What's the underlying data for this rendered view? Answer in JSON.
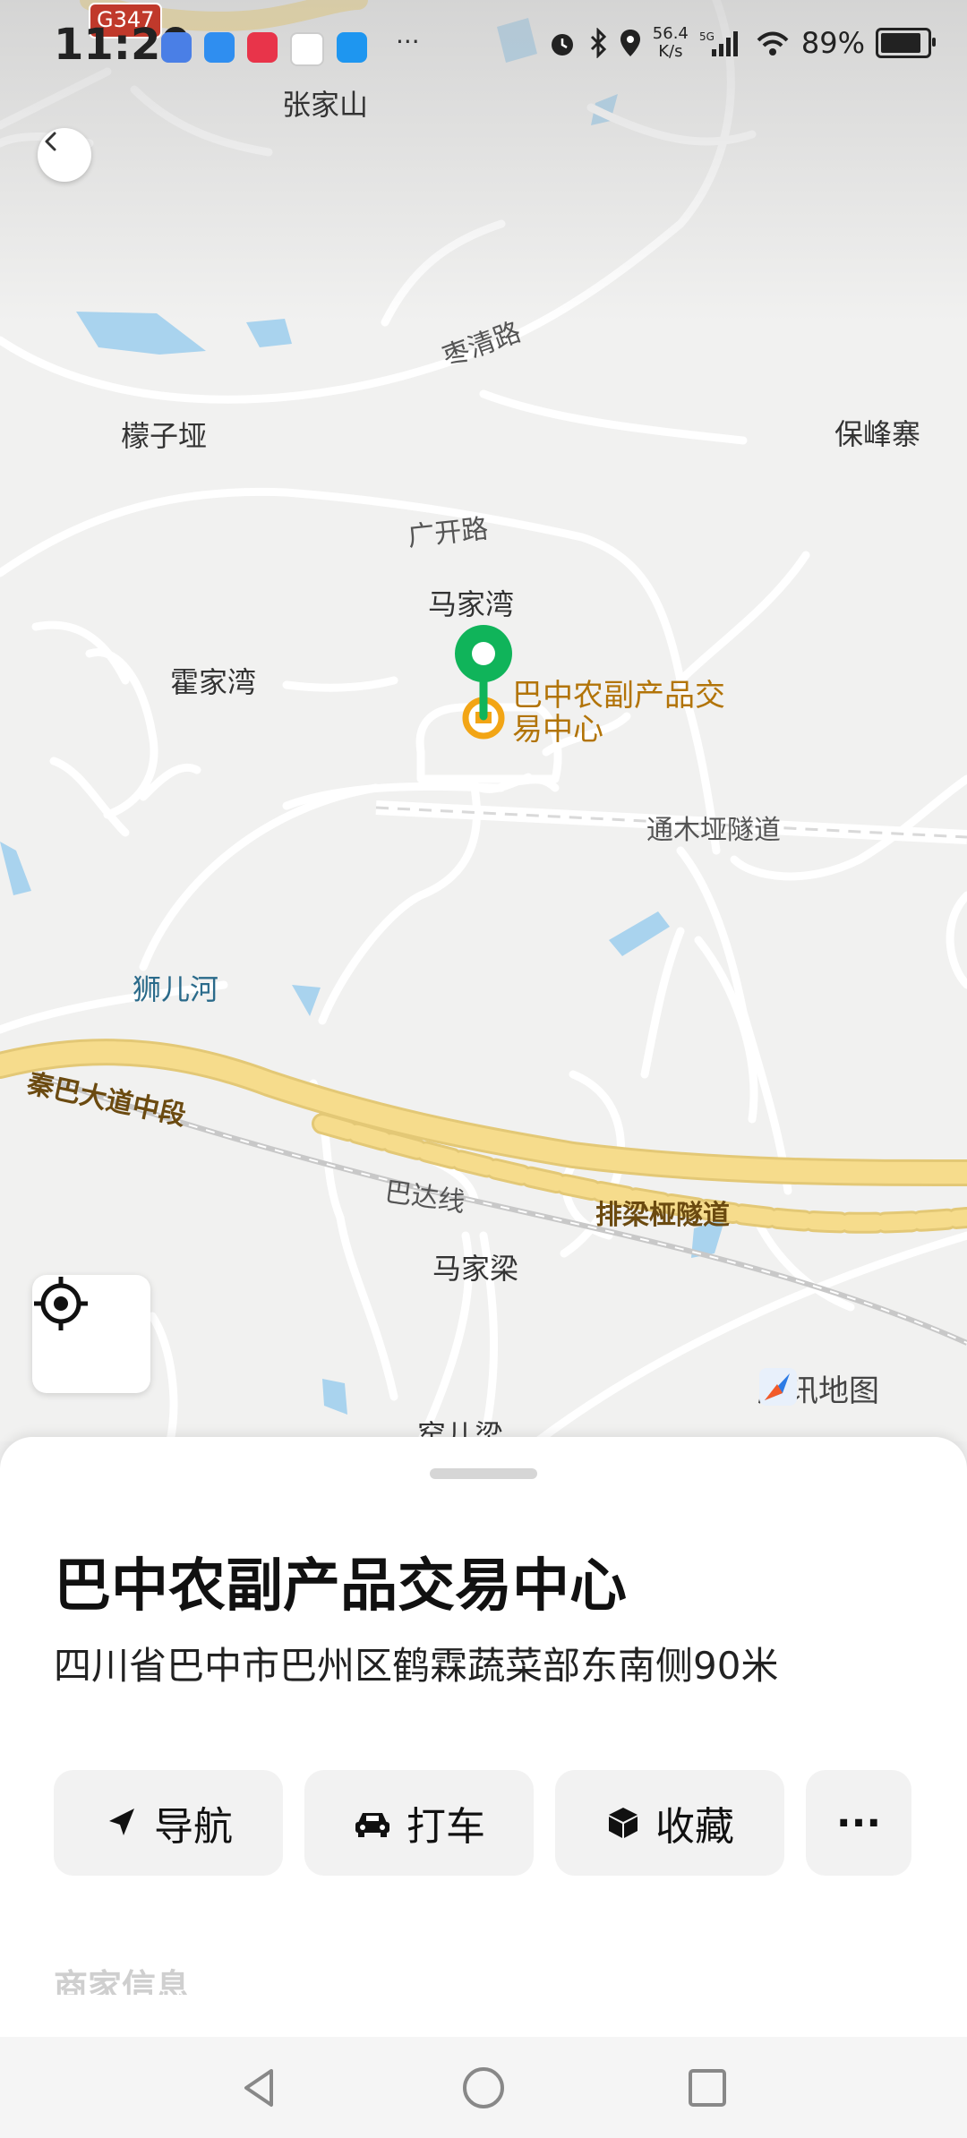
{
  "status_bar": {
    "time": "11:20",
    "speed_value": "56.4",
    "speed_unit": "K/s",
    "battery": "89%",
    "more": "···"
  },
  "map": {
    "road_sign": "G347",
    "labels": {
      "zhangjiashan": "张家山",
      "zaoqinglu": "枣清路",
      "mengziya": "檬子垭",
      "baofengzhai": "保峰寨",
      "guangkailu": "广开路",
      "majiawan": "马家湾",
      "huojiawan": "霍家湾",
      "tongmuya_tunnel": "通木垭隧道",
      "shierhe": "狮儿河",
      "qinbadadao": "秦巴大道中段",
      "badaxian": "巴达线",
      "pailiangya_tunnel": "排梁桠隧道",
      "majialiang": "马家梁",
      "yaoerliang": "窑儿梁"
    },
    "poi_name": "巴中农副产品交易中心",
    "logo_text": "腾讯地图",
    "colors": {
      "pin": "#10b45a",
      "poi": "#f2a515",
      "highway": "#f6dc8c"
    }
  },
  "sheet": {
    "title": "巴中农副产品交易中心",
    "address": "四川省巴中市巴州区鹤霖蔬菜部东南侧90米",
    "actions": {
      "navigate": "导航",
      "taxi": "打车",
      "favorite": "收藏",
      "more": "···"
    },
    "section_peek": "商家信息"
  }
}
